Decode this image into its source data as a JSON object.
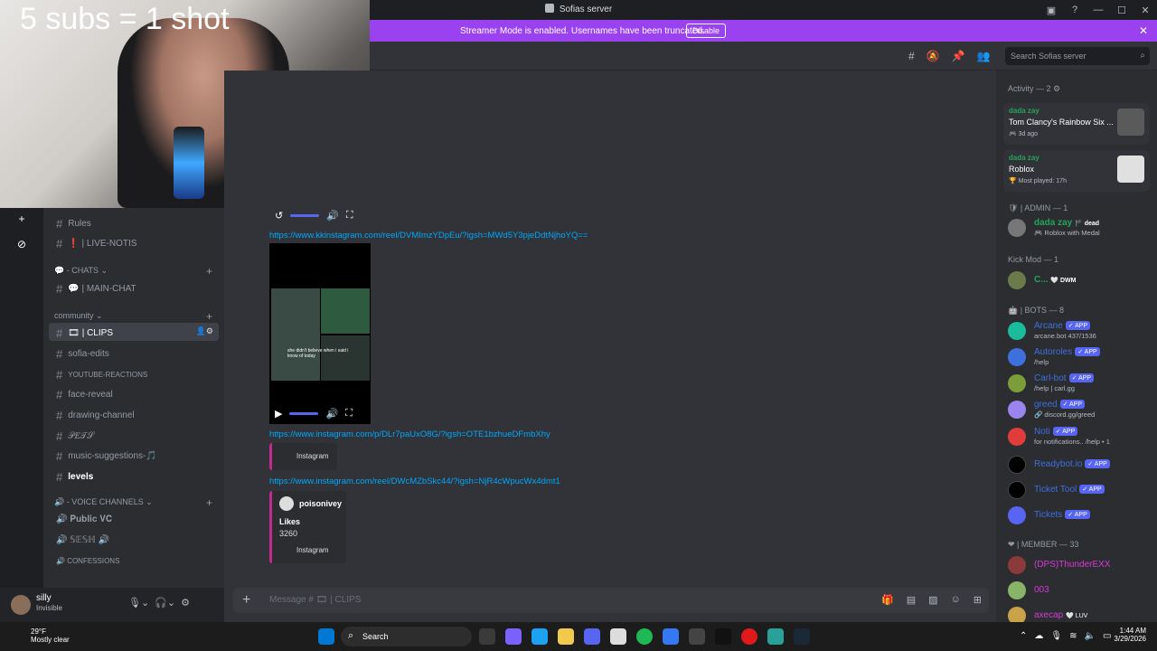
{
  "window": {
    "title": "Sofias server"
  },
  "banner": {
    "message": "Streamer Mode is enabled. Usernames have been truncated.",
    "button": "Disable"
  },
  "header": {
    "search_placeholder": "Search Sofias server"
  },
  "webcam": {
    "overlay_text": "5 subs = 1 shot"
  },
  "sidebar": {
    "channels_top": [
      {
        "label": "Rules"
      },
      {
        "label": "❗ | LIVE-NOTIS"
      }
    ],
    "cat_chats": "💬 - CHATS ⌄",
    "main_chat": "💬 | MAIN-CHAT",
    "cat_community": "community ⌄",
    "clips": "🎞 | CLIPS",
    "community_channels": [
      {
        "label": "sofia-edits"
      },
      {
        "label": "YOUTUBE-REACTIONS"
      },
      {
        "label": "face-reveal"
      },
      {
        "label": "drawing-channel"
      },
      {
        "label": "𝒫𝐸𝒯𝒮"
      },
      {
        "label": "music-suggestions-🎵"
      },
      {
        "label": "𝐥𝐞𝐯𝐞𝐥𝐬"
      }
    ],
    "cat_voice": "🔊 - VOICE CHANNELS ⌄",
    "voice": [
      {
        "label": "🔊 𝐏𝐮𝐛𝐥𝐢𝐜 𝐕𝐂"
      },
      {
        "label": "🔊 𝕊𝔼𝕊ℍ 🔊"
      },
      {
        "label": "🔊 CONFESSIONS"
      }
    ]
  },
  "user": {
    "name": "silly",
    "status": "Invisible"
  },
  "messages": {
    "link1": "https://www.kkinstagram.com/reel/DVMImzYDpEu/?igsh=MWd5Y3pjeDdtNjhoYQ==",
    "link2": "https://www.instagram.com/p/DLr7paUxO8G/?igsh=OTE1bzhueDFmbXhy",
    "embed1_provider": "Instagram",
    "link3": "https://www.instagram.com/reel/DWcMZbSkc44/?igsh=NjR4cWpucWx4dmt1",
    "embed2": {
      "author": "poisonivey",
      "field_name": "Likes",
      "field_value": "3260",
      "provider": "Instagram"
    },
    "video_caption": "she didn't believe when i said i know of today"
  },
  "composer": {
    "placeholder": "Message # 🎞 | CLIPS"
  },
  "members": {
    "activity_header": "Activity — 2 ⚙",
    "activities": [
      {
        "user": "dada zay",
        "game": "Tom Clancy's Rainbow Six ...",
        "time": "🎮 3d ago"
      },
      {
        "user": "dada zay",
        "game": "Roblox",
        "time": "🏆 Most played: 17h"
      }
    ],
    "admin_header": "🛡 | ADMIN — 1",
    "admin": {
      "name": "dada zay",
      "tag": "🏴 dead",
      "sub": "🎮 Roblox with Medal"
    },
    "kick_header": "Kick Mod — 1",
    "kick": {
      "name": "C...",
      "tag": "🤍 DWM"
    },
    "bots_header": "🤖 | BOTS — 8",
    "bots": [
      {
        "name": "Arcane",
        "badge": "✓ APP",
        "sub": "arcane.bot 437/1536",
        "color": "#1abc9c"
      },
      {
        "name": "Autoroles",
        "badge": "✓ APP",
        "sub": "/help",
        "color": "#3e70dd"
      },
      {
        "name": "Carl-bot",
        "badge": "✓ APP",
        "sub": "/help | carl.gg",
        "color": "#7b9e3a"
      },
      {
        "name": "greed",
        "badge": "✓ APP",
        "sub": "🔗 discord.gg/greed",
        "color": "#9c84ef"
      },
      {
        "name": "Noti",
        "badge": "✓ APP",
        "sub": "for notifications.. /help • 1",
        "color": "#e03c3c"
      },
      {
        "name": "Readybot.io",
        "badge": "✓ APP",
        "sub": "",
        "color": "#000000"
      },
      {
        "name": "Ticket Tool",
        "badge": "✓ APP",
        "sub": "",
        "color": "#000000"
      },
      {
        "name": "Tickets",
        "badge": "✓ APP",
        "sub": "",
        "color": "#5865f2"
      }
    ],
    "member_header": "❤ | MEMBER — 33",
    "member_list": [
      {
        "name": "(DPS)ThunderEXX",
        "color": "#d63ad6"
      },
      {
        "name": "003",
        "color": "#d63ad6"
      },
      {
        "name": "axecap",
        "tag": "🤍 LUV",
        "color": "#d63ad6"
      }
    ]
  },
  "taskbar": {
    "temp": "29°F",
    "weather": "Mostly clear",
    "search": "Search",
    "time": "1:44 AM",
    "date": "3/29/2026"
  },
  "colors": {
    "accent": "#5865f2",
    "banner": "#9b42f0",
    "link": "#00a8fc"
  }
}
